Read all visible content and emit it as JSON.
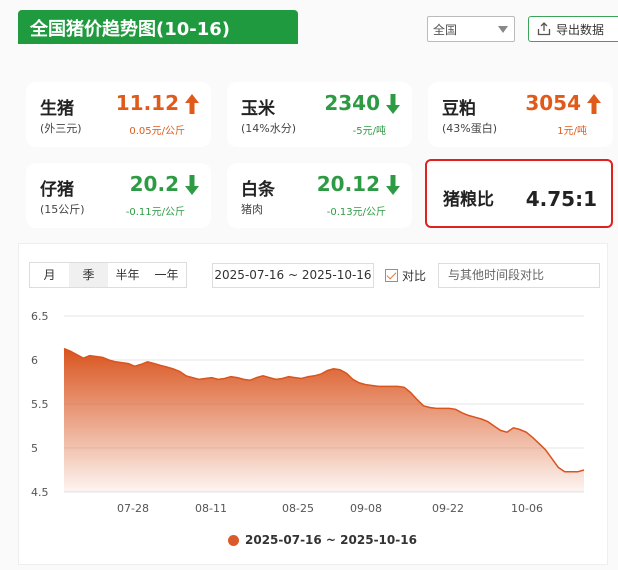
{
  "header": {
    "title": "全国猪价趋势图(10-16)",
    "region": "全国",
    "export_label": "导出数据"
  },
  "cards": [
    {
      "name": "生猪",
      "sub": "(外三元)",
      "value": "11.12",
      "change": "0.05元/公斤",
      "direction": "up"
    },
    {
      "name": "玉米",
      "sub": "(14%水分)",
      "value": "2340",
      "change": "-5元/吨",
      "direction": "down"
    },
    {
      "name": "豆粕",
      "sub": "(43%蛋白)",
      "value": "3054",
      "change": "1元/吨",
      "direction": "up"
    },
    {
      "name": "仔猪",
      "sub": "(15公斤)",
      "value": "20.2",
      "change": "-0.11元/公斤",
      "direction": "down"
    },
    {
      "name": "白条",
      "sub": "猪肉",
      "value": "20.12",
      "change": "-0.13元/公斤",
      "direction": "down"
    }
  ],
  "ratio": {
    "name": "猪粮比",
    "value": "4.75:1"
  },
  "controls": {
    "tabs": [
      "月",
      "季",
      "半年",
      "一年"
    ],
    "active_tab": 1,
    "date_range": "2025-07-16 ~ 2025-10-16",
    "compare_label": "对比",
    "compare_placeholder": "与其他时间段对比"
  },
  "colors": {
    "up": "#e05a1a",
    "down": "#2e9b44",
    "accent": "#1f9a3f",
    "series": "#d95a2a"
  },
  "chart_data": {
    "type": "area",
    "ylim": [
      4.5,
      6.5
    ],
    "yticks": [
      "6.5",
      "6",
      "5.5",
      "5",
      "4.5"
    ],
    "xtick_labels": [
      "07-28",
      "08-11",
      "08-25",
      "09-08",
      "09-22",
      "10-06"
    ],
    "legend": "2025-07-16 ~ 2025-10-16",
    "series": [
      {
        "values": [
          6.13,
          6.1,
          6.06,
          6.02,
          6.05,
          6.04,
          6.03,
          6.0,
          5.98,
          5.97,
          5.96,
          5.93,
          5.95,
          5.98,
          5.96,
          5.94,
          5.92,
          5.9,
          5.87,
          5.82,
          5.8,
          5.78,
          5.79,
          5.8,
          5.78,
          5.79,
          5.81,
          5.8,
          5.78,
          5.77,
          5.8,
          5.82,
          5.8,
          5.78,
          5.79,
          5.81,
          5.8,
          5.79,
          5.81,
          5.82,
          5.84,
          5.88,
          5.9,
          5.89,
          5.85,
          5.78,
          5.74,
          5.72,
          5.71,
          5.7,
          5.7,
          5.7,
          5.7,
          5.69,
          5.63,
          5.55,
          5.48,
          5.46,
          5.45,
          5.45,
          5.45,
          5.44,
          5.4,
          5.37,
          5.35,
          5.33,
          5.3,
          5.25,
          5.2,
          5.18,
          5.23,
          5.21,
          5.18,
          5.12,
          5.05,
          4.98,
          4.88,
          4.78,
          4.73,
          4.73,
          4.73,
          4.75
        ]
      }
    ]
  }
}
